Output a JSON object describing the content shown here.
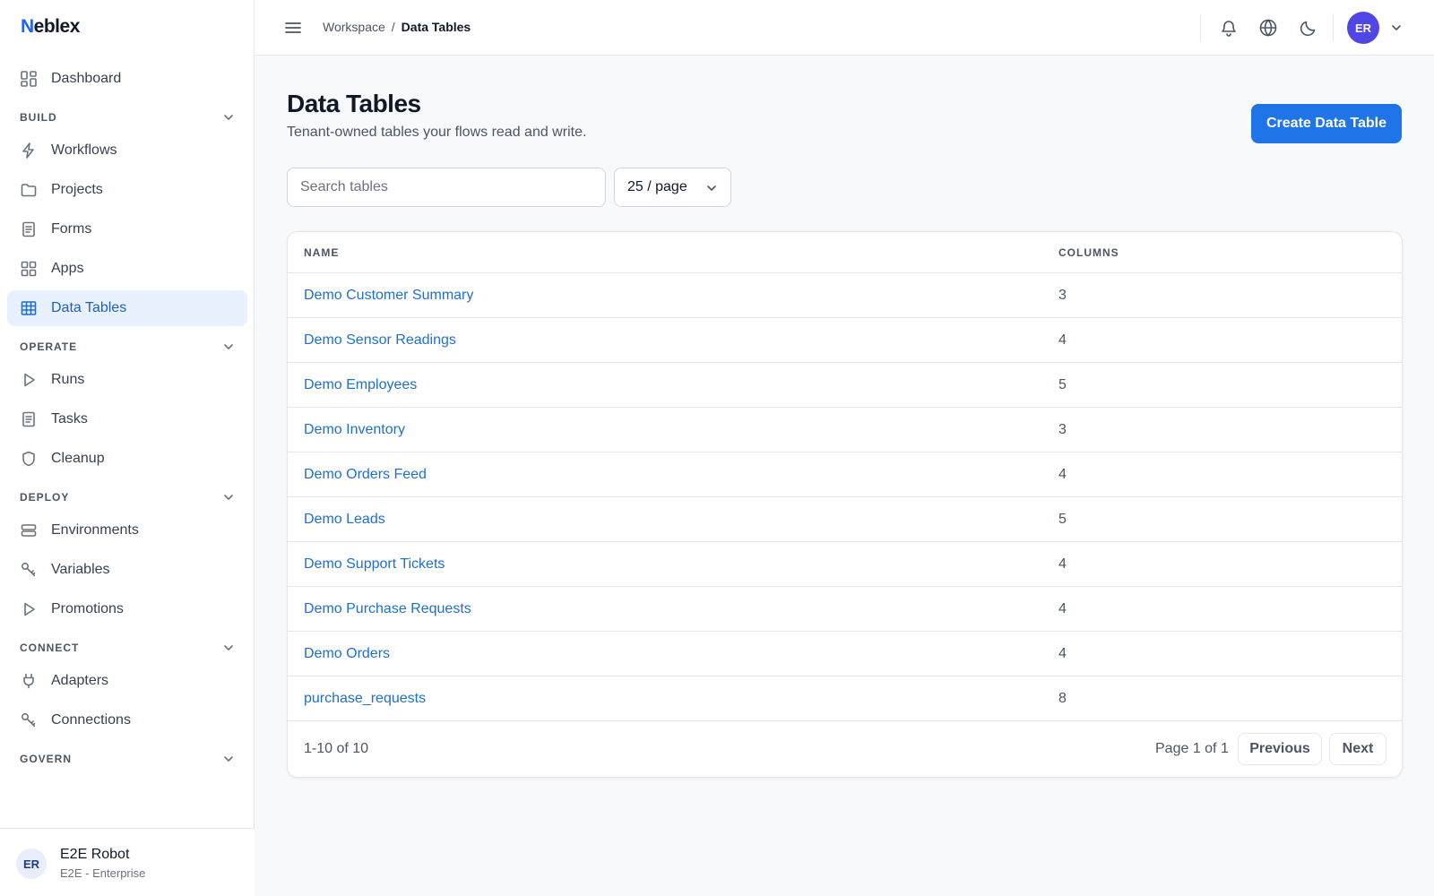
{
  "app": {
    "logo_first": "N",
    "logo_rest": "eblex"
  },
  "sidebar": {
    "dashboard": "Dashboard",
    "sections": [
      {
        "title": "BUILD",
        "items": [
          {
            "label": "Workflows",
            "icon": "bolt-icon"
          },
          {
            "label": "Projects",
            "icon": "folder-icon"
          },
          {
            "label": "Forms",
            "icon": "document-icon"
          },
          {
            "label": "Apps",
            "icon": "grid-icon"
          },
          {
            "label": "Data Tables",
            "icon": "table-icon",
            "active": true
          }
        ]
      },
      {
        "title": "OPERATE",
        "items": [
          {
            "label": "Runs",
            "icon": "play-icon"
          },
          {
            "label": "Tasks",
            "icon": "document-icon"
          },
          {
            "label": "Cleanup",
            "icon": "shield-icon"
          }
        ]
      },
      {
        "title": "DEPLOY",
        "items": [
          {
            "label": "Environments",
            "icon": "server-icon"
          },
          {
            "label": "Variables",
            "icon": "key-icon"
          },
          {
            "label": "Promotions",
            "icon": "play-icon"
          }
        ]
      },
      {
        "title": "CONNECT",
        "items": [
          {
            "label": "Adapters",
            "icon": "plug-icon"
          },
          {
            "label": "Connections",
            "icon": "key-icon"
          }
        ]
      },
      {
        "title": "GOVERN",
        "items": []
      }
    ]
  },
  "user": {
    "initials": "ER",
    "name": "E2E Robot",
    "org": "E2E - Enterprise"
  },
  "topbar": {
    "breadcrumb_root": "Workspace",
    "breadcrumb_sep": "/",
    "breadcrumb_current": "Data Tables",
    "avatar_initials": "ER"
  },
  "page": {
    "title": "Data Tables",
    "subtitle": "Tenant-owned tables your flows read and write.",
    "create_label": "Create Data Table",
    "search_placeholder": "Search tables",
    "page_size": "25 / page"
  },
  "table": {
    "headers": [
      "NAME",
      "COLUMNS"
    ],
    "rows": [
      {
        "name": "Demo Customer Summary",
        "columns": "3"
      },
      {
        "name": "Demo Sensor Readings",
        "columns": "4"
      },
      {
        "name": "Demo Employees",
        "columns": "5"
      },
      {
        "name": "Demo Inventory",
        "columns": "3"
      },
      {
        "name": "Demo Orders Feed",
        "columns": "4"
      },
      {
        "name": "Demo Leads",
        "columns": "5"
      },
      {
        "name": "Demo Support Tickets",
        "columns": "4"
      },
      {
        "name": "Demo Purchase Requests",
        "columns": "4"
      },
      {
        "name": "Demo Orders",
        "columns": "4"
      },
      {
        "name": "purchase_requests",
        "columns": "8"
      }
    ],
    "range": "1-10 of 10",
    "page_info": "Page 1 of 1",
    "prev_label": "Previous",
    "next_label": "Next"
  }
}
